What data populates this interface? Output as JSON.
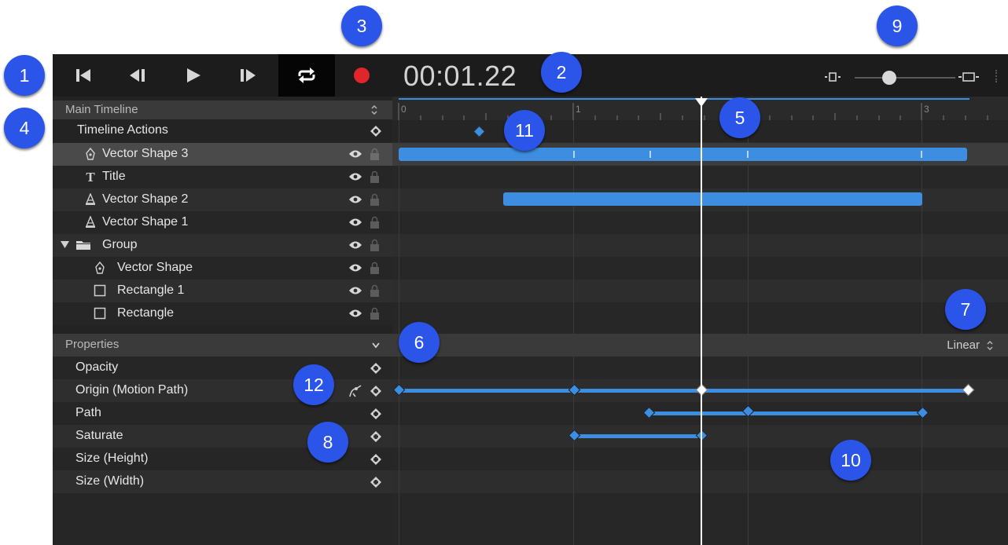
{
  "transport": {
    "buttons": [
      {
        "name": "go-to-start-button",
        "icon": "skip-to-start-icon"
      },
      {
        "name": "previous-frame-button",
        "icon": "step-back-icon"
      },
      {
        "name": "play-button",
        "icon": "play-icon"
      },
      {
        "name": "next-frame-button",
        "icon": "step-forward-icon"
      },
      {
        "name": "loop-button",
        "icon": "loop-icon"
      },
      {
        "name": "record-button",
        "icon": "record-icon"
      }
    ],
    "timecode": "00:01.22"
  },
  "zoom": {
    "value": 0.46,
    "min_icon": "zoom-out-icon",
    "max_icon": "zoom-in-icon"
  },
  "timeline": {
    "selector_label": "Main Timeline",
    "actions_label": "Timeline Actions",
    "layers": [
      {
        "label": "Vector Shape 3",
        "icon": "pen-icon",
        "selected": true
      },
      {
        "label": "Title",
        "icon": "text-icon"
      },
      {
        "label": "Vector Shape 2",
        "icon": "pencil-shape-icon"
      },
      {
        "label": "Vector Shape 1",
        "icon": "pencil-shape-icon"
      },
      {
        "label": "Group",
        "icon": "folder-icon",
        "expanded": true
      },
      {
        "label": "Vector Shape",
        "icon": "pen-icon",
        "child": true
      },
      {
        "label": "Rectangle 1",
        "icon": "rectangle-icon",
        "child": true
      },
      {
        "label": "Rectangle",
        "icon": "rectangle-icon",
        "child": true
      }
    ],
    "ruler_labels": [
      "0",
      "1",
      "3"
    ],
    "playhead_seconds": 1.73
  },
  "properties": {
    "header": "Properties",
    "interpolation": "Linear",
    "items": [
      {
        "label": "Opacity"
      },
      {
        "label": "Origin (Motion Path)",
        "has_path_icon": true
      },
      {
        "label": "Path"
      },
      {
        "label": "Saturate"
      },
      {
        "label": "Size (Height)"
      },
      {
        "label": "Size (Width)"
      }
    ]
  },
  "callouts": [
    "1",
    "2",
    "3",
    "4",
    "5",
    "6",
    "7",
    "8",
    "9",
    "10",
    "11",
    "12"
  ],
  "colors": {
    "accent": "#3d8ee0",
    "badge": "#2a55e8",
    "record": "#e0252b"
  }
}
